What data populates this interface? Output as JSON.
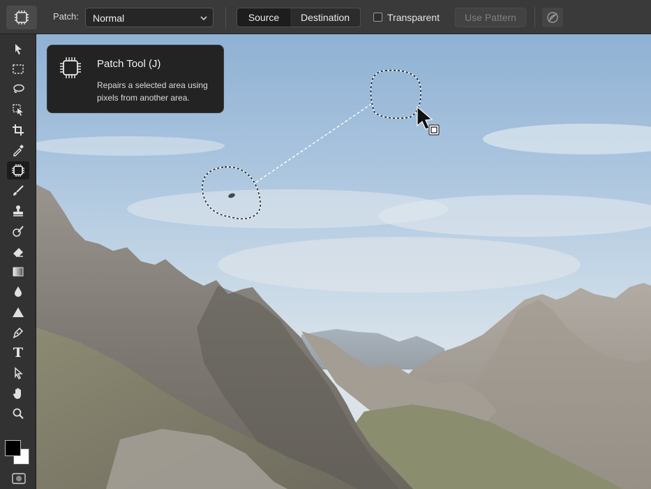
{
  "options_bar": {
    "tool_preset_icon": "patch-tool-icon",
    "patch_label": "Patch:",
    "patch_mode_value": "Normal",
    "source_label": "Source",
    "destination_label": "Destination",
    "selected_segment": "Source",
    "transparent_label": "Transparent",
    "transparent_checked": false,
    "use_pattern_label": "Use Pattern",
    "use_pattern_enabled": false,
    "diffusion_icon": "diffusion-icon"
  },
  "toolbar": {
    "tools": [
      {
        "name": "move-tool",
        "icon": "move-arrow-icon"
      },
      {
        "name": "rectangular-marquee-tool",
        "icon": "marquee-icon"
      },
      {
        "name": "lasso-tool",
        "icon": "lasso-icon"
      },
      {
        "name": "object-selection-tool",
        "icon": "object-selection-icon"
      },
      {
        "name": "crop-tool",
        "icon": "crop-icon"
      },
      {
        "name": "eyedropper-tool",
        "icon": "eyedropper-icon"
      },
      {
        "name": "patch-tool",
        "icon": "patch-icon",
        "active": true
      },
      {
        "name": "brush-tool",
        "icon": "brush-icon"
      },
      {
        "name": "clone-stamp-tool",
        "icon": "stamp-icon"
      },
      {
        "name": "history-brush-tool",
        "icon": "history-brush-icon"
      },
      {
        "name": "eraser-tool",
        "icon": "eraser-icon"
      },
      {
        "name": "gradient-tool",
        "icon": "gradient-icon"
      },
      {
        "name": "blur-tool",
        "icon": "drop-icon"
      },
      {
        "name": "dodge-tool",
        "icon": "triangle-icon"
      },
      {
        "name": "pen-tool",
        "icon": "pen-icon"
      },
      {
        "name": "type-tool",
        "icon": "type-icon"
      },
      {
        "name": "path-selection-tool",
        "icon": "path-selection-icon"
      },
      {
        "name": "hand-tool",
        "icon": "hand-icon"
      },
      {
        "name": "zoom-tool",
        "icon": "zoom-icon"
      }
    ],
    "type_tool_glyph": "T",
    "foreground_color": "#000000",
    "background_color": "#ffffff"
  },
  "tooltip": {
    "title": "Patch Tool (J)",
    "description": "Repairs a selected area using pixels from another area."
  },
  "colors": {
    "panel": "#323232",
    "options_bar": "#3a3a3a",
    "sky_top": "#8fb1d4",
    "sky_bottom": "#dfe5e8",
    "rock": "#8a8580"
  }
}
